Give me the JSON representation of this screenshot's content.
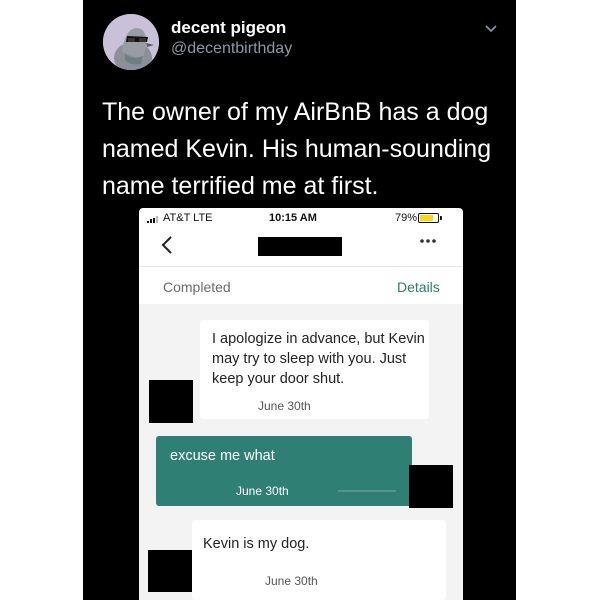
{
  "tweet": {
    "display_name": "decent pigeon",
    "handle": "@decentbirthday",
    "text": "The owner of my AirBnB has a dog named Kevin. His human-sounding name terrified me at first.",
    "icons": {
      "avatar": "pigeon-with-sunglasses",
      "menu": "chevron-down-icon"
    }
  },
  "phone": {
    "status_bar": {
      "carrier": "AT&T  LTE",
      "time": "10:15 AM",
      "battery_percent": "79%",
      "battery_level": 0.79
    },
    "header": {
      "back_icon": "chevron-left-icon",
      "more_icon": "more-horizontal-icon"
    },
    "trip_status": "Completed",
    "details_link": "Details",
    "messages": [
      {
        "direction": "incoming",
        "text": "I apologize in advance, but Kevin may try to sleep with you. Just keep your door shut.",
        "date": "June 30th"
      },
      {
        "direction": "outgoing",
        "text": "excuse me what",
        "date": "June 30th"
      },
      {
        "direction": "incoming",
        "text": "Kevin is my dog.",
        "date": "June 30th"
      }
    ]
  },
  "colors": {
    "tweet_background": "#000000",
    "handle": "#8b98a5",
    "accent": "#2a7f69",
    "outgoing_bubble": "#2f7f75",
    "thread_background": "#f3f3f3"
  }
}
